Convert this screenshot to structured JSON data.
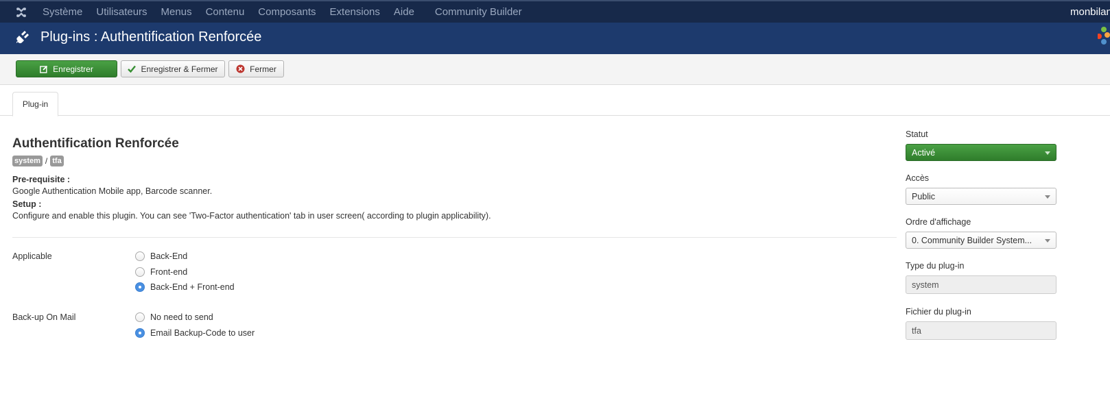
{
  "topbar": {
    "menu": [
      "Système",
      "Utilisateurs",
      "Menus",
      "Contenu",
      "Composants",
      "Extensions",
      "Aide"
    ],
    "community_builder": "Community Builder",
    "user": "monbilan"
  },
  "header": {
    "title": "Plug-ins : Authentification Renforcée"
  },
  "toolbar": {
    "save_label": "Enregistrer",
    "save_close_label": "Enregistrer & Fermer",
    "close_label": "Fermer"
  },
  "tabs": [
    {
      "label": "Plug-in"
    }
  ],
  "plugin": {
    "title": "Authentification Renforcée",
    "badges": [
      "system",
      "tfa"
    ],
    "separator": "/",
    "prereq_label": "Pre-requisite :",
    "prereq_text": "Google Authentication Mobile app, Barcode scanner.",
    "setup_label": "Setup :",
    "setup_text": "Configure and enable this plugin. You can see 'Two-Factor authentication' tab in user screen( according to plugin applicability)."
  },
  "fields": {
    "applicable": {
      "label": "Applicable",
      "options": [
        "Back-End",
        "Front-end",
        "Back-End + Front-end"
      ],
      "selected": "Back-End + Front-end"
    },
    "backup": {
      "label": "Back-up On Mail",
      "options": [
        "No need to send",
        "Email Backup-Code to user"
      ],
      "selected": "Email Backup-Code to user"
    }
  },
  "side": {
    "status_label": "Statut",
    "status_value": "Activé",
    "access_label": "Accès",
    "access_value": "Public",
    "order_label": "Ordre d'affichage",
    "order_value": "0. Community Builder System...",
    "type_label": "Type du plug-in",
    "type_value": "system",
    "file_label": "Fichier du plug-in",
    "file_value": "tfa"
  },
  "colors": {
    "topbar": "#17294a",
    "header": "#1d3a6d",
    "success": "#378f33",
    "radio_selected": "#4a90e2"
  }
}
